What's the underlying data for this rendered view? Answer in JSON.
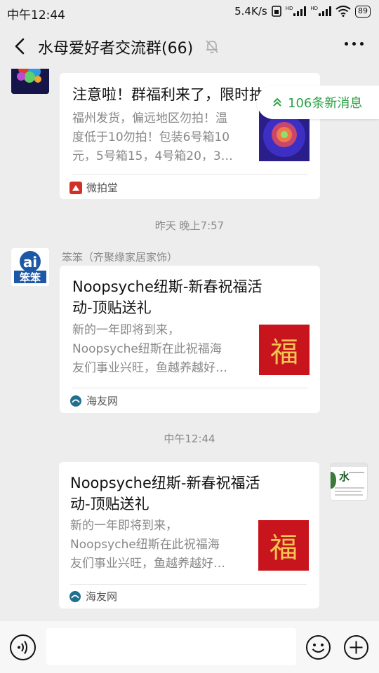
{
  "status_bar": {
    "time": "中午12:44",
    "net_speed": "5.4K/s",
    "signal1_label": "HD",
    "signal2_label": "HD",
    "battery": "89"
  },
  "header": {
    "title": "水母爱好者交流群(66)",
    "back_icon": "back-arrow-icon",
    "mute_icon": "bell-muted-icon",
    "more_icon": "more-dots-icon"
  },
  "new_messages": {
    "label": "106条新消息"
  },
  "messages": [
    {
      "sender": "",
      "title": "注意啦！群福利来了，限时抽",
      "desc_lines": [
        "福州发货，偏远地区勿拍！温",
        "度低于10勿拍！包装6号箱10",
        "元，5号箱15，4号箱20，3…"
      ],
      "source": "微拍堂"
    },
    {
      "timestamp": "昨天 晚上7:57",
      "sender": "笨笨（齐聚缘家居家饰）",
      "title_lines": [
        "Noopsyche纽斯-新春祝福活",
        "动-顶贴送礼"
      ],
      "desc_lines": [
        "新的一年即将到来，",
        "Noopsyche纽斯在此祝福海",
        "友们事业兴旺，鱼越养越好…"
      ],
      "thumb_char": "福",
      "source": "海友网"
    },
    {
      "timestamp": "中午12:44",
      "title_lines": [
        "Noopsyche纽斯-新春祝福活",
        "动-顶贴送礼"
      ],
      "desc_lines": [
        "新的一年即将到来，",
        "Noopsyche纽斯在此祝福海",
        "友们事业兴旺，鱼越养越好…"
      ],
      "thumb_char": "福",
      "source": "海友网",
      "self_avatar_char": "水"
    }
  ],
  "avatar2_text": {
    "top": "ai",
    "bottom": "笨笨"
  },
  "input_bar": {
    "voice_icon": "voice-icon",
    "emoji_icon": "emoji-icon",
    "plus_icon": "plus-icon"
  },
  "colors": {
    "background": "#ededed",
    "accent_green": "#2ba245",
    "fu_red": "#c8141c"
  }
}
